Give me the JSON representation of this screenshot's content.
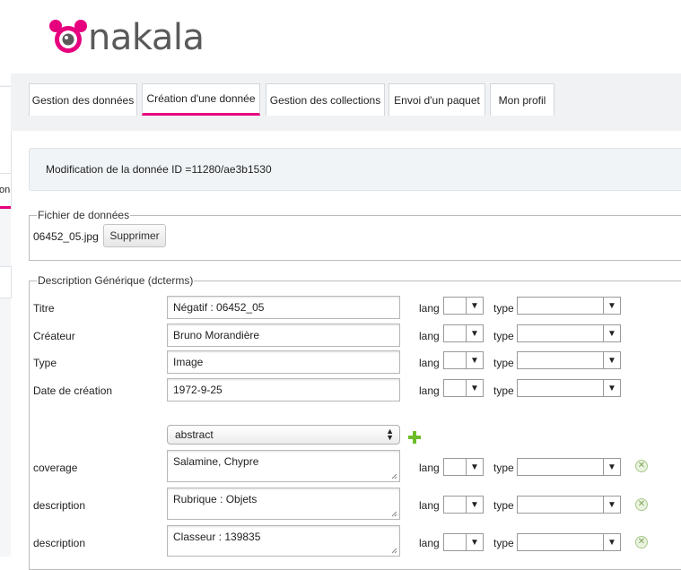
{
  "brand": {
    "name": "nakala",
    "accent": "#e6007e"
  },
  "sidebar": {
    "partial_text": "on"
  },
  "tabs": [
    {
      "label": "Gestion des données"
    },
    {
      "label": "Création d'une donnée"
    },
    {
      "label": "Gestion des collections"
    },
    {
      "label": "Envoi d'un paquet"
    },
    {
      "label": "Mon profil"
    }
  ],
  "active_tab": "Création d'une donnée",
  "info": {
    "text": "Modification de la donnée ID =11280/ae3b1530"
  },
  "file_section": {
    "legend": "Fichier de données",
    "filename": "06452_05.jpg",
    "delete_label": "Supprimer"
  },
  "description_section": {
    "legend": "Description Générique (dcterms)",
    "lang_label": "lang",
    "type_label": "type",
    "fields": [
      {
        "label": "Titre",
        "value": "Négatif : 06452_05"
      },
      {
        "label": "Créateur",
        "value": "Bruno Morandière"
      },
      {
        "label": "Type",
        "value": "Image"
      },
      {
        "label": "Date de création",
        "value": "1972-9-25"
      }
    ],
    "add_select_value": "abstract",
    "extra_fields": [
      {
        "label": "coverage",
        "value": "Salamine, Chypre"
      },
      {
        "label": "description",
        "value": "Rubrique : Objets"
      },
      {
        "label": "description",
        "value": "Classeur : 139835"
      }
    ]
  },
  "icons": {
    "logo": "nakala-mascot-icon",
    "add": "plus-icon",
    "remove": "remove-circle-icon",
    "select_caret": "caret-down-icon"
  }
}
